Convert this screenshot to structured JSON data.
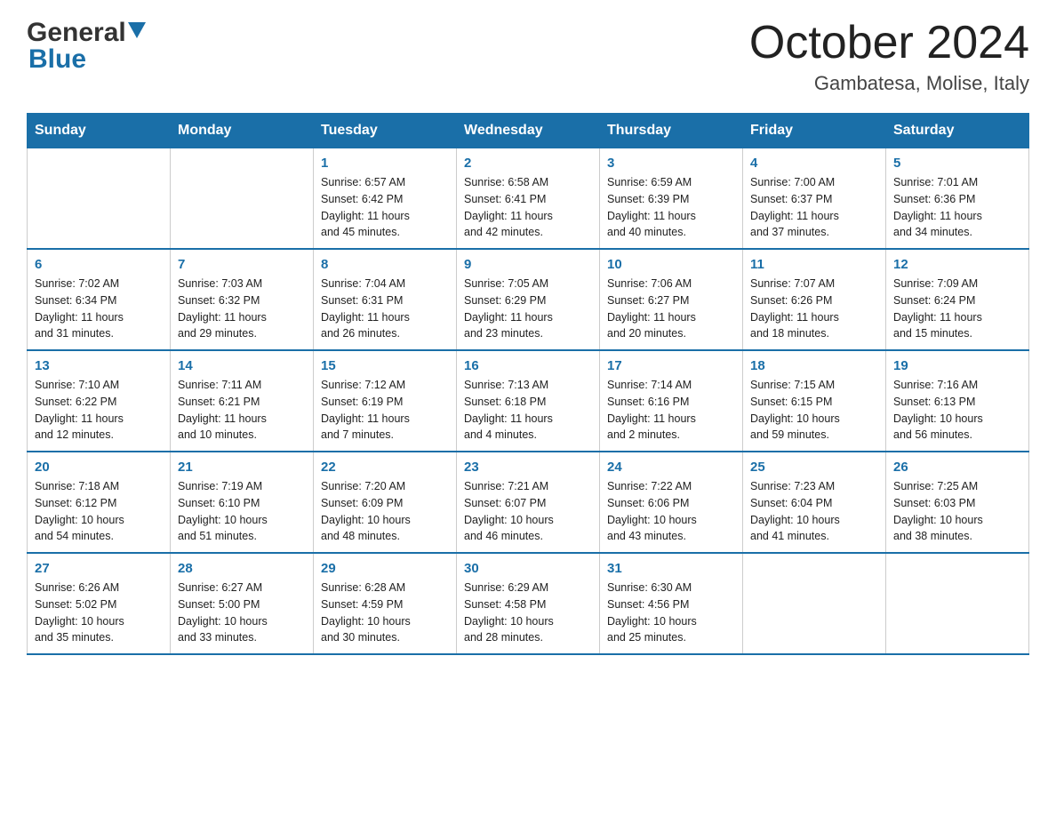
{
  "header": {
    "logo_general": "General",
    "logo_blue": "Blue",
    "month_title": "October 2024",
    "location": "Gambatesa, Molise, Italy"
  },
  "days_of_week": [
    "Sunday",
    "Monday",
    "Tuesday",
    "Wednesday",
    "Thursday",
    "Friday",
    "Saturday"
  ],
  "weeks": [
    [
      {
        "day": "",
        "info": ""
      },
      {
        "day": "",
        "info": ""
      },
      {
        "day": "1",
        "info": "Sunrise: 6:57 AM\nSunset: 6:42 PM\nDaylight: 11 hours\nand 45 minutes."
      },
      {
        "day": "2",
        "info": "Sunrise: 6:58 AM\nSunset: 6:41 PM\nDaylight: 11 hours\nand 42 minutes."
      },
      {
        "day": "3",
        "info": "Sunrise: 6:59 AM\nSunset: 6:39 PM\nDaylight: 11 hours\nand 40 minutes."
      },
      {
        "day": "4",
        "info": "Sunrise: 7:00 AM\nSunset: 6:37 PM\nDaylight: 11 hours\nand 37 minutes."
      },
      {
        "day": "5",
        "info": "Sunrise: 7:01 AM\nSunset: 6:36 PM\nDaylight: 11 hours\nand 34 minutes."
      }
    ],
    [
      {
        "day": "6",
        "info": "Sunrise: 7:02 AM\nSunset: 6:34 PM\nDaylight: 11 hours\nand 31 minutes."
      },
      {
        "day": "7",
        "info": "Sunrise: 7:03 AM\nSunset: 6:32 PM\nDaylight: 11 hours\nand 29 minutes."
      },
      {
        "day": "8",
        "info": "Sunrise: 7:04 AM\nSunset: 6:31 PM\nDaylight: 11 hours\nand 26 minutes."
      },
      {
        "day": "9",
        "info": "Sunrise: 7:05 AM\nSunset: 6:29 PM\nDaylight: 11 hours\nand 23 minutes."
      },
      {
        "day": "10",
        "info": "Sunrise: 7:06 AM\nSunset: 6:27 PM\nDaylight: 11 hours\nand 20 minutes."
      },
      {
        "day": "11",
        "info": "Sunrise: 7:07 AM\nSunset: 6:26 PM\nDaylight: 11 hours\nand 18 minutes."
      },
      {
        "day": "12",
        "info": "Sunrise: 7:09 AM\nSunset: 6:24 PM\nDaylight: 11 hours\nand 15 minutes."
      }
    ],
    [
      {
        "day": "13",
        "info": "Sunrise: 7:10 AM\nSunset: 6:22 PM\nDaylight: 11 hours\nand 12 minutes."
      },
      {
        "day": "14",
        "info": "Sunrise: 7:11 AM\nSunset: 6:21 PM\nDaylight: 11 hours\nand 10 minutes."
      },
      {
        "day": "15",
        "info": "Sunrise: 7:12 AM\nSunset: 6:19 PM\nDaylight: 11 hours\nand 7 minutes."
      },
      {
        "day": "16",
        "info": "Sunrise: 7:13 AM\nSunset: 6:18 PM\nDaylight: 11 hours\nand 4 minutes."
      },
      {
        "day": "17",
        "info": "Sunrise: 7:14 AM\nSunset: 6:16 PM\nDaylight: 11 hours\nand 2 minutes."
      },
      {
        "day": "18",
        "info": "Sunrise: 7:15 AM\nSunset: 6:15 PM\nDaylight: 10 hours\nand 59 minutes."
      },
      {
        "day": "19",
        "info": "Sunrise: 7:16 AM\nSunset: 6:13 PM\nDaylight: 10 hours\nand 56 minutes."
      }
    ],
    [
      {
        "day": "20",
        "info": "Sunrise: 7:18 AM\nSunset: 6:12 PM\nDaylight: 10 hours\nand 54 minutes."
      },
      {
        "day": "21",
        "info": "Sunrise: 7:19 AM\nSunset: 6:10 PM\nDaylight: 10 hours\nand 51 minutes."
      },
      {
        "day": "22",
        "info": "Sunrise: 7:20 AM\nSunset: 6:09 PM\nDaylight: 10 hours\nand 48 minutes."
      },
      {
        "day": "23",
        "info": "Sunrise: 7:21 AM\nSunset: 6:07 PM\nDaylight: 10 hours\nand 46 minutes."
      },
      {
        "day": "24",
        "info": "Sunrise: 7:22 AM\nSunset: 6:06 PM\nDaylight: 10 hours\nand 43 minutes."
      },
      {
        "day": "25",
        "info": "Sunrise: 7:23 AM\nSunset: 6:04 PM\nDaylight: 10 hours\nand 41 minutes."
      },
      {
        "day": "26",
        "info": "Sunrise: 7:25 AM\nSunset: 6:03 PM\nDaylight: 10 hours\nand 38 minutes."
      }
    ],
    [
      {
        "day": "27",
        "info": "Sunrise: 6:26 AM\nSunset: 5:02 PM\nDaylight: 10 hours\nand 35 minutes."
      },
      {
        "day": "28",
        "info": "Sunrise: 6:27 AM\nSunset: 5:00 PM\nDaylight: 10 hours\nand 33 minutes."
      },
      {
        "day": "29",
        "info": "Sunrise: 6:28 AM\nSunset: 4:59 PM\nDaylight: 10 hours\nand 30 minutes."
      },
      {
        "day": "30",
        "info": "Sunrise: 6:29 AM\nSunset: 4:58 PM\nDaylight: 10 hours\nand 28 minutes."
      },
      {
        "day": "31",
        "info": "Sunrise: 6:30 AM\nSunset: 4:56 PM\nDaylight: 10 hours\nand 25 minutes."
      },
      {
        "day": "",
        "info": ""
      },
      {
        "day": "",
        "info": ""
      }
    ]
  ]
}
